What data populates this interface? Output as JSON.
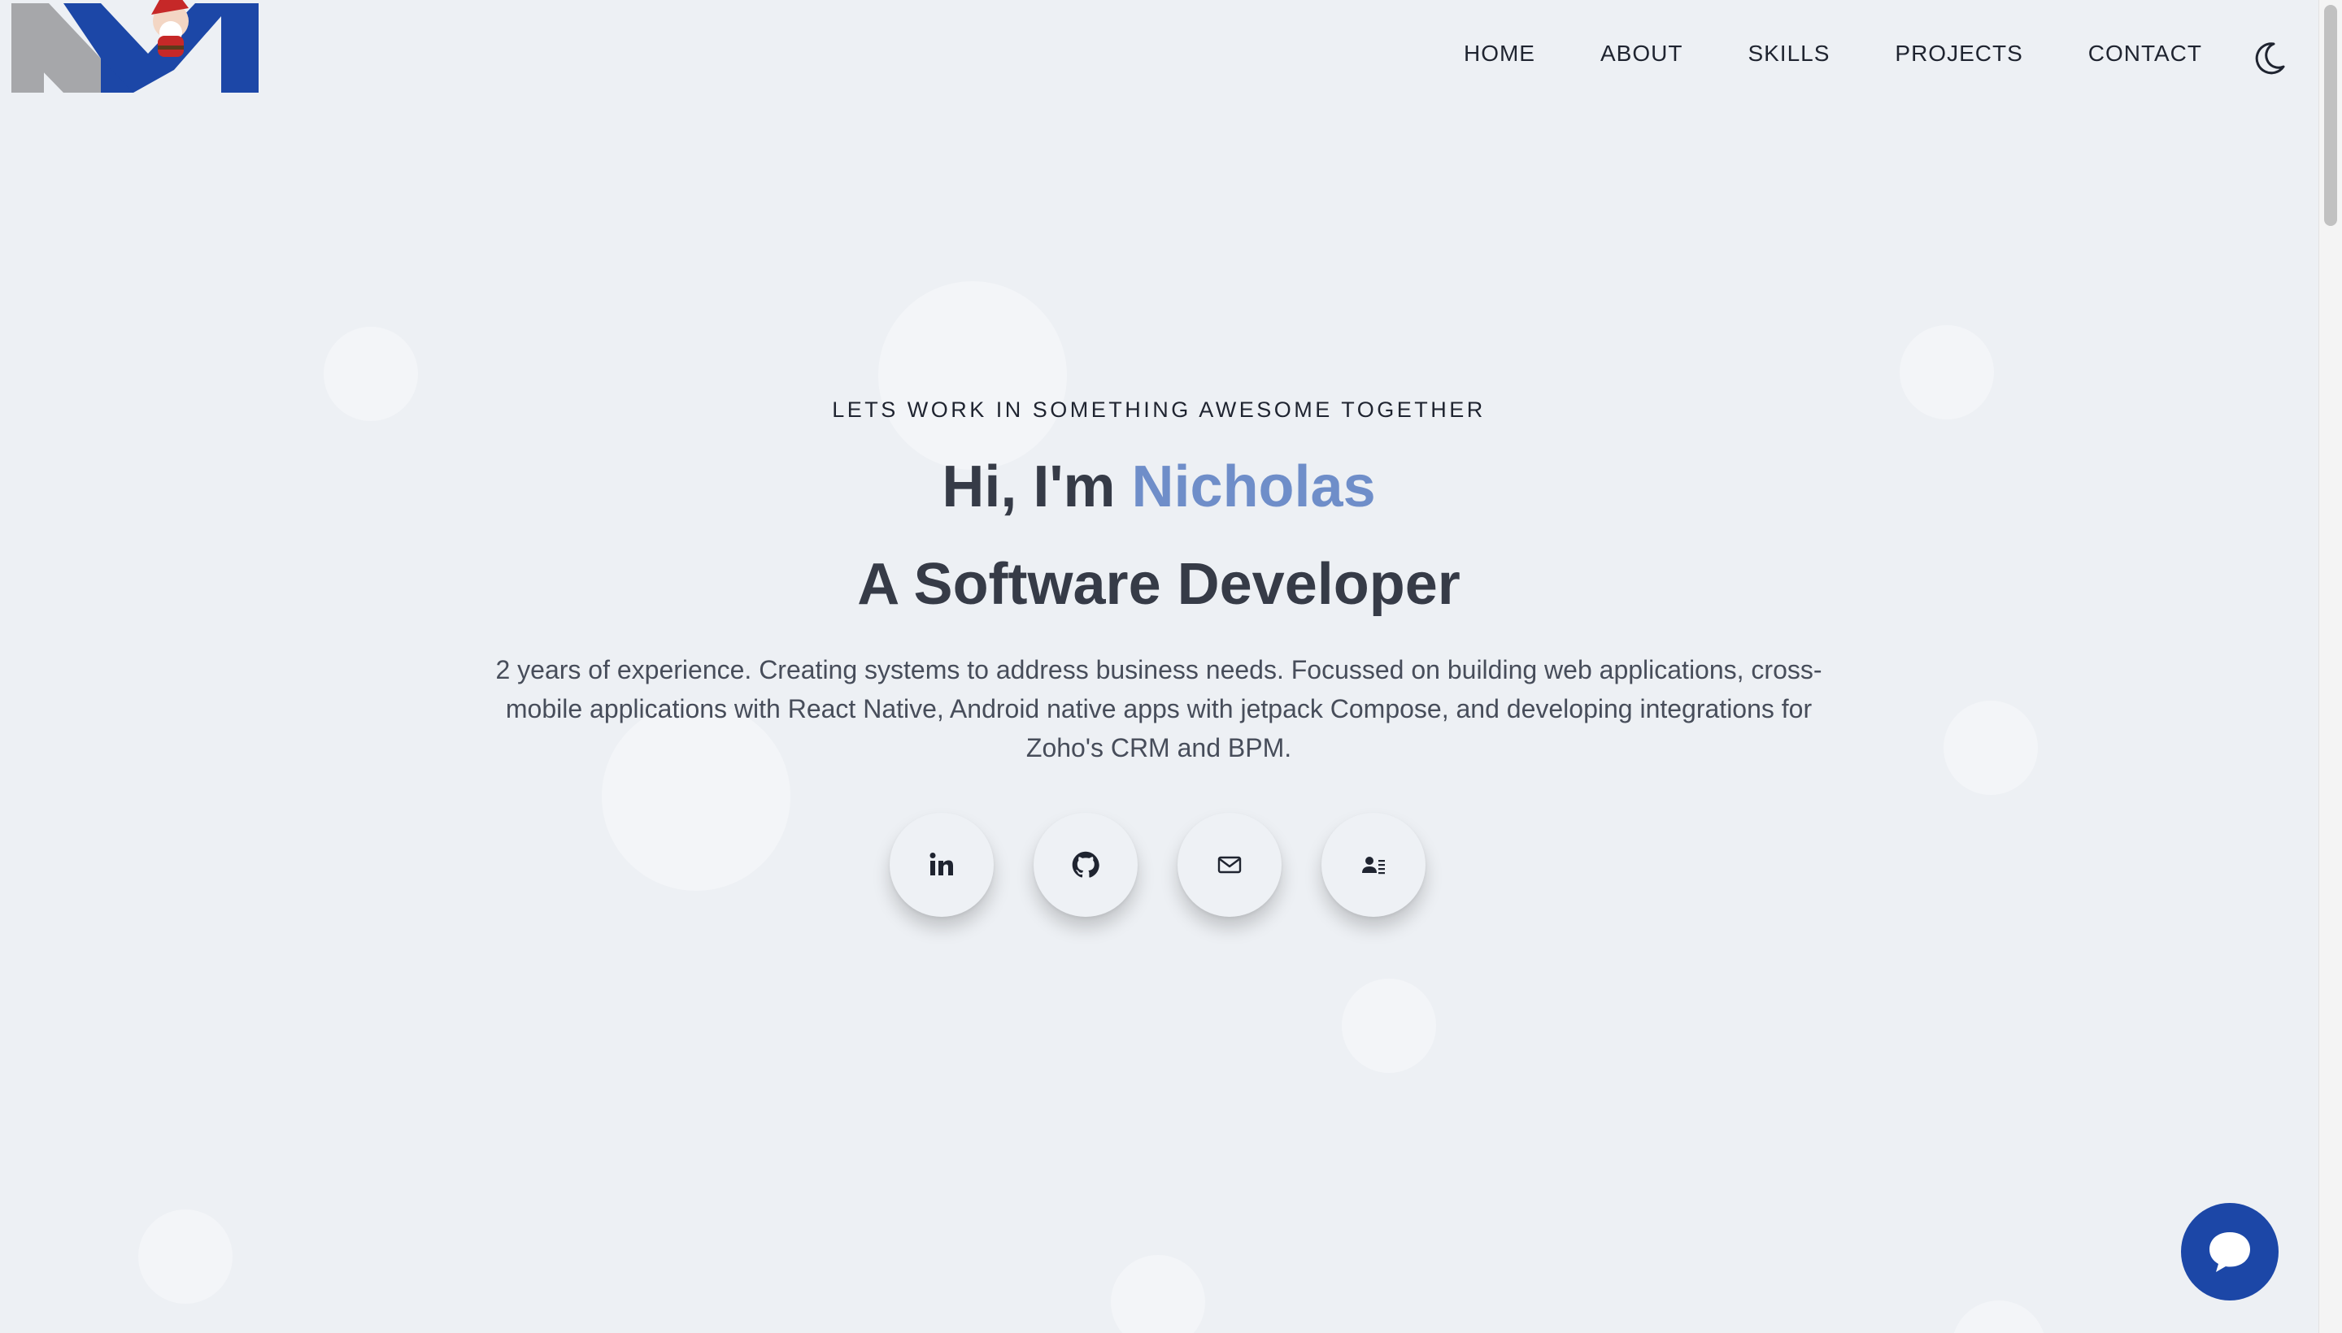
{
  "header": {
    "logo_alt": "NM",
    "nav": [
      {
        "label": "HOME"
      },
      {
        "label": "ABOUT"
      },
      {
        "label": "SKILLS"
      },
      {
        "label": "PROJECTS"
      },
      {
        "label": "CONTACT"
      }
    ],
    "theme_toggle_icon": "moon-icon"
  },
  "hero": {
    "tagline": "LETS WORK IN SOMETHING AWESOME TOGETHER",
    "greeting_prefix": "Hi, I'm ",
    "name": "Nicholas",
    "role": "A Software Developer",
    "description": "2 years of experience. Creating systems to address business needs. Focussed on building web applications, cross-mobile applications with React Native, Android native apps with jetpack Compose, and developing integrations for Zoho's CRM and BPM."
  },
  "socials": [
    {
      "name": "linkedin-icon"
    },
    {
      "name": "github-icon"
    },
    {
      "name": "mail-icon"
    },
    {
      "name": "contact-card-icon"
    }
  ],
  "chat": {
    "icon": "chat-bubble-icon"
  },
  "colors": {
    "background": "#edf0f4",
    "accent_name": "#6f8ec9",
    "logo_blue": "#1c47a7",
    "logo_gray": "#a6a7aa",
    "chat_button": "#1c47a7"
  }
}
